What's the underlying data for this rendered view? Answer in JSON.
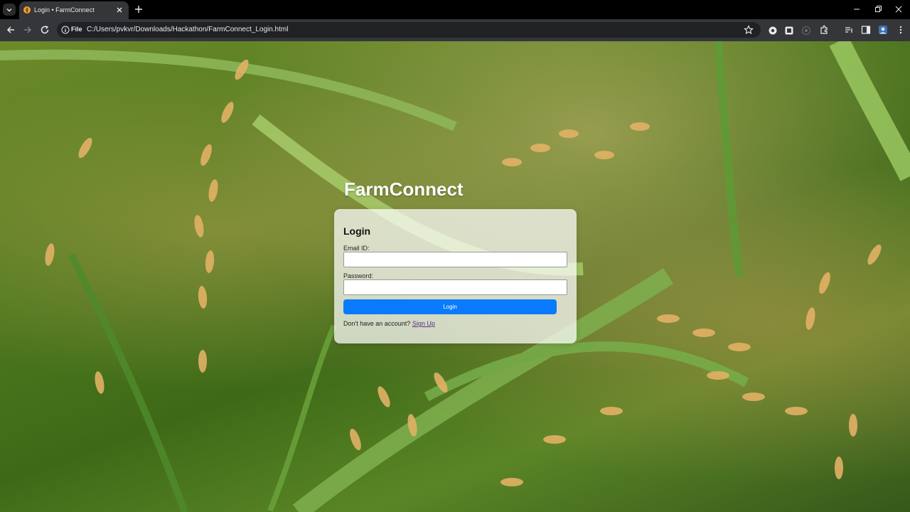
{
  "browser": {
    "tab": {
      "title": "Login • FarmConnect"
    },
    "address_bar": {
      "scheme_label": "File",
      "url": "C:/Users/pvkvr/Downloads/Hackathon/FarmConnect_Login.html"
    },
    "icons": [
      "tab-list-icon",
      "favicon-icon",
      "close-tab-icon",
      "new-tab-icon",
      "minimize-icon",
      "maximize-icon",
      "close-window-icon",
      "back-icon",
      "forward-icon",
      "reload-icon",
      "site-info-icon",
      "bookmark-star-icon",
      "extension-icon",
      "side-panel-icon",
      "profile-icon",
      "menu-icon"
    ]
  },
  "page": {
    "brand": "FarmConnect",
    "form": {
      "title": "Login",
      "email_label": "Email ID:",
      "email_value": "",
      "password_label": "Password:",
      "password_value": "",
      "submit_label": "Login",
      "signup_prompt": "Don't have an account?",
      "signup_link": "Sign Up"
    },
    "colors": {
      "button": "#0a7bff",
      "link": "#5a2c8a",
      "card": "rgba(255,255,255,0.72)"
    }
  }
}
